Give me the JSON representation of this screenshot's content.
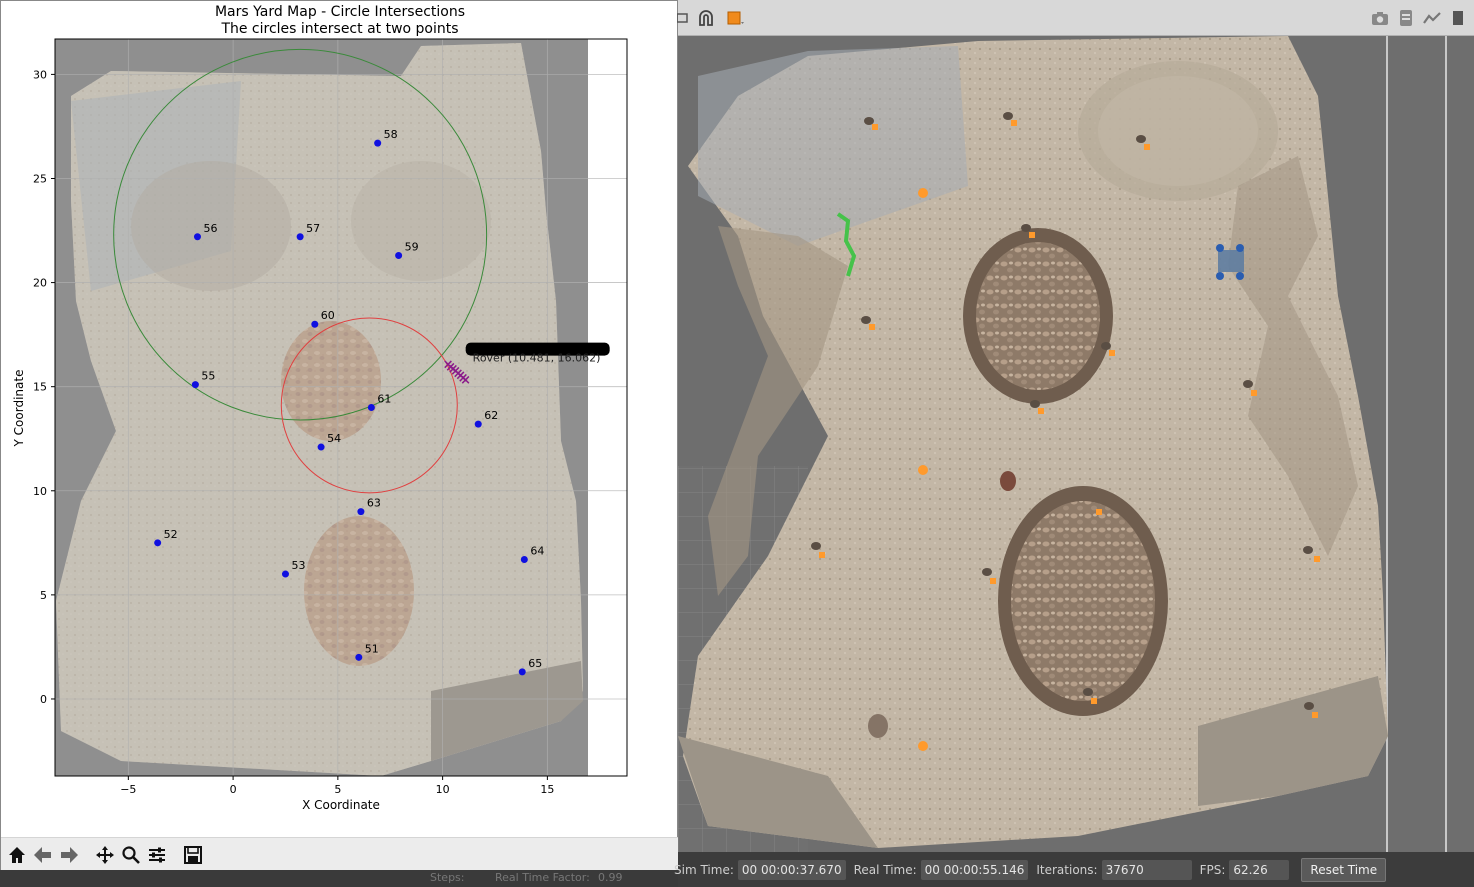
{
  "figure": {
    "title_line1": "Mars Yard Map - Circle Intersections",
    "title_line2": "The circles intersect at two points",
    "toolbar_buttons": [
      "home-icon",
      "back-icon",
      "forward-icon",
      "pan-icon",
      "zoom-icon",
      "configure-icon",
      "save-icon"
    ]
  },
  "chart_data": {
    "type": "scatter",
    "title": "Mars Yard Map - Circle Intersections",
    "subtitle": "The circles intersect at two points",
    "xlabel": "X Coordinate",
    "ylabel": "Y Coordinate",
    "xlim": [
      -8.5,
      18.8
    ],
    "ylim": [
      -3.7,
      31.7
    ],
    "xticks": [
      -5,
      0,
      5,
      10,
      15
    ],
    "yticks": [
      0,
      5,
      10,
      15,
      20,
      25,
      30
    ],
    "grid": true,
    "markers": [
      {
        "id": "51",
        "x": 6.0,
        "y": 2.0
      },
      {
        "id": "52",
        "x": -3.6,
        "y": 7.5
      },
      {
        "id": "53",
        "x": 2.5,
        "y": 6.0
      },
      {
        "id": "54",
        "x": 4.2,
        "y": 12.1
      },
      {
        "id": "55",
        "x": -1.8,
        "y": 15.1
      },
      {
        "id": "56",
        "x": -1.7,
        "y": 22.2
      },
      {
        "id": "57",
        "x": 3.2,
        "y": 22.2
      },
      {
        "id": "58",
        "x": 6.9,
        "y": 26.7
      },
      {
        "id": "59",
        "x": 7.9,
        "y": 21.3
      },
      {
        "id": "60",
        "x": 3.9,
        "y": 18.0
      },
      {
        "id": "61",
        "x": 6.6,
        "y": 14.0
      },
      {
        "id": "62",
        "x": 11.7,
        "y": 13.2
      },
      {
        "id": "63",
        "x": 6.1,
        "y": 9.0
      },
      {
        "id": "64",
        "x": 13.9,
        "y": 6.7
      },
      {
        "id": "65",
        "x": 13.8,
        "y": 1.3
      }
    ],
    "circles": [
      {
        "color": "#3a8a3a",
        "cx": 3.2,
        "cy": 22.3,
        "r": 8.9
      },
      {
        "color": "#e04040",
        "cx": 6.5,
        "cy": 14.1,
        "r": 4.2
      }
    ],
    "rover": {
      "label": "Rover (10.481, 16.062)",
      "x": 10.48,
      "y": 16.06
    },
    "colors": {
      "marker": "#1010e0",
      "rover": "#8a1a8a"
    }
  },
  "gazebo": {
    "status": {
      "sim_time_label": "Sim Time:",
      "sim_time_value": "00 00:00:37.670",
      "real_time_label": "Real Time:",
      "real_time_value": "00 00:00:55.146",
      "iterations_label": "Iterations:",
      "iterations_value": "37670",
      "fps_label": "FPS:",
      "fps_value": "62.26",
      "reset_label": "Reset Time"
    },
    "toolbar_icons": [
      "screenshot-icon",
      "log-icon",
      "plot-icon",
      "panel-icon"
    ]
  },
  "bottom_strip": {
    "steps": "Steps:",
    "rtf": "Real Time Factor:",
    "rtf_value": "0.99"
  }
}
